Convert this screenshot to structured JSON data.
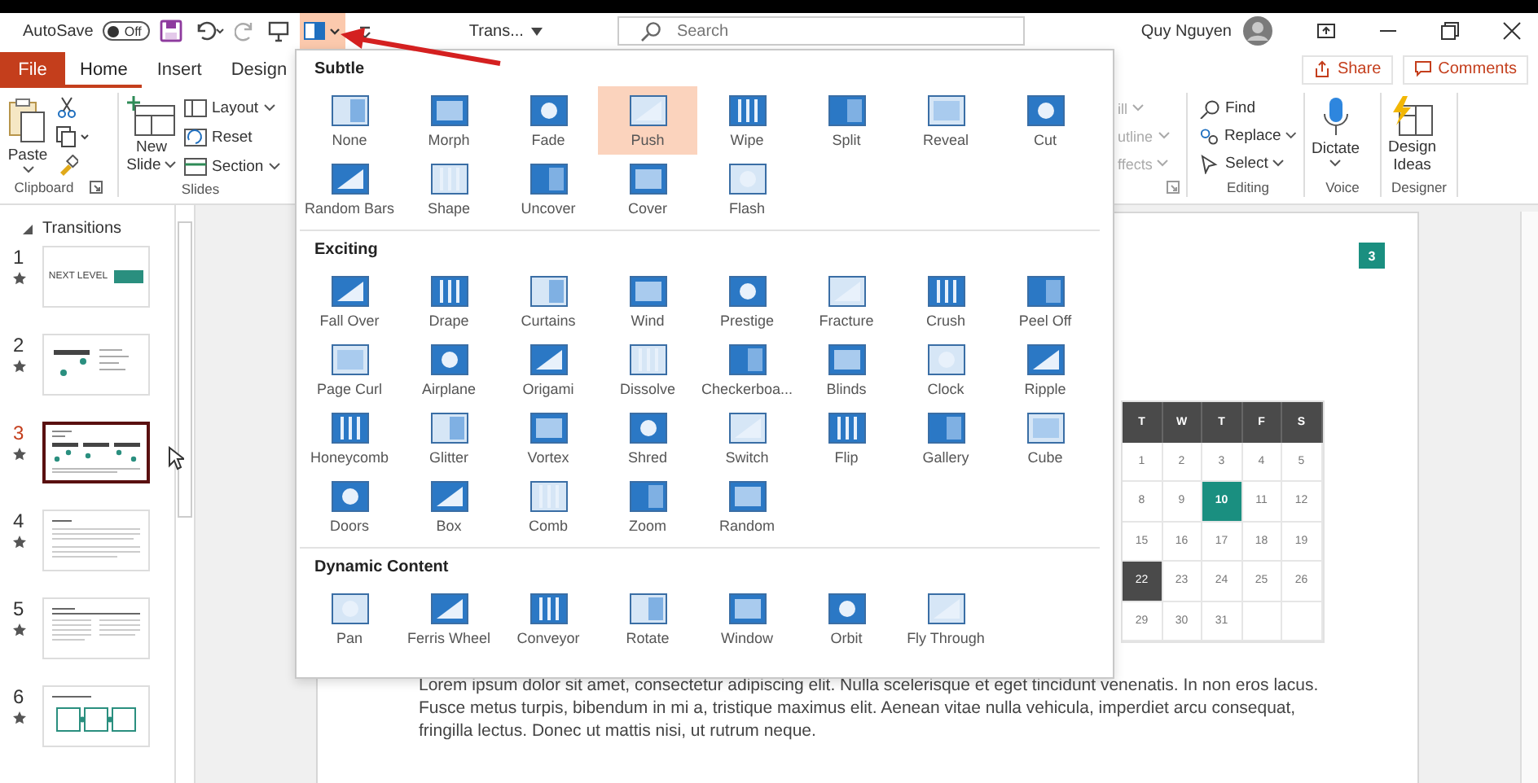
{
  "top_bar": {
    "autosave_label": "AutoSave",
    "autosave_toggle": {
      "label": "Off",
      "on": false
    },
    "document_title": "Trans...",
    "search": {
      "placeholder": "Search"
    },
    "user_name": "Quy Nguyen"
  },
  "ribbon_tabs": [
    {
      "label": "File",
      "kind": "file",
      "selected": false
    },
    {
      "label": "Home",
      "kind": "tab",
      "selected": true
    },
    {
      "label": "Insert",
      "kind": "tab",
      "selected": false
    },
    {
      "label": "Design",
      "kind": "tab",
      "selected": false
    }
  ],
  "share_button": "Share",
  "comments_button": "Comments",
  "ribbon": {
    "paste": "Paste",
    "clipboard_label": "Clipboard",
    "new_slide": [
      "New",
      "Slide"
    ],
    "layout": "Layout",
    "reset": "Reset",
    "section": "Section",
    "slides_label": "Slides",
    "cut_items": [
      "ill",
      "utline",
      "ffects"
    ],
    "find": "Find",
    "replace": "Replace",
    "select": "Select",
    "editing_label": "Editing",
    "dictate": "Dictate",
    "voice_label": "Voice",
    "design_ideas": [
      "Design",
      "Ideas"
    ],
    "designer_label": "Designer"
  },
  "slides_panel": {
    "section": "Transitions",
    "slides": [
      {
        "number": "1",
        "kind": "title",
        "text": "NEXT LEVEL",
        "selected": false
      },
      {
        "number": "2",
        "kind": "dots",
        "selected": false
      },
      {
        "number": "3",
        "kind": "timeline",
        "selected": true
      },
      {
        "number": "4",
        "kind": "text",
        "selected": false
      },
      {
        "number": "5",
        "kind": "columns",
        "selected": false
      },
      {
        "number": "6",
        "kind": "boxes",
        "selected": false
      }
    ]
  },
  "gallery": {
    "sections": [
      {
        "title": "Subtle",
        "items": [
          {
            "label": "None",
            "selected": false
          },
          {
            "label": "Morph",
            "selected": false
          },
          {
            "label": "Fade",
            "selected": false
          },
          {
            "label": "Push",
            "selected": true
          },
          {
            "label": "Wipe",
            "selected": false
          },
          {
            "label": "Split",
            "selected": false
          },
          {
            "label": "Reveal",
            "selected": false
          },
          {
            "label": "Cut",
            "selected": false
          },
          {
            "label": "Random Bars",
            "selected": false
          },
          {
            "label": "Shape",
            "selected": false
          },
          {
            "label": "Uncover",
            "selected": false
          },
          {
            "label": "Cover",
            "selected": false
          },
          {
            "label": "Flash",
            "selected": false
          }
        ]
      },
      {
        "title": "Exciting",
        "items": [
          {
            "label": "Fall Over",
            "selected": false
          },
          {
            "label": "Drape",
            "selected": false
          },
          {
            "label": "Curtains",
            "selected": false
          },
          {
            "label": "Wind",
            "selected": false
          },
          {
            "label": "Prestige",
            "selected": false
          },
          {
            "label": "Fracture",
            "selected": false
          },
          {
            "label": "Crush",
            "selected": false
          },
          {
            "label": "Peel Off",
            "selected": false
          },
          {
            "label": "Page Curl",
            "selected": false
          },
          {
            "label": "Airplane",
            "selected": false
          },
          {
            "label": "Origami",
            "selected": false
          },
          {
            "label": "Dissolve",
            "selected": false
          },
          {
            "label": "Checkerboa...",
            "selected": false
          },
          {
            "label": "Blinds",
            "selected": false
          },
          {
            "label": "Clock",
            "selected": false
          },
          {
            "label": "Ripple",
            "selected": false
          },
          {
            "label": "Honeycomb",
            "selected": false
          },
          {
            "label": "Glitter",
            "selected": false
          },
          {
            "label": "Vortex",
            "selected": false
          },
          {
            "label": "Shred",
            "selected": false
          },
          {
            "label": "Switch",
            "selected": false
          },
          {
            "label": "Flip",
            "selected": false
          },
          {
            "label": "Gallery",
            "selected": false
          },
          {
            "label": "Cube",
            "selected": false
          },
          {
            "label": "Doors",
            "selected": false
          },
          {
            "label": "Box",
            "selected": false
          },
          {
            "label": "Comb",
            "selected": false
          },
          {
            "label": "Zoom",
            "selected": false
          },
          {
            "label": "Random",
            "selected": false
          }
        ]
      },
      {
        "title": "Dynamic Content",
        "items": [
          {
            "label": "Pan",
            "selected": false
          },
          {
            "label": "Ferris Wheel",
            "selected": false
          },
          {
            "label": "Conveyor",
            "selected": false
          },
          {
            "label": "Rotate",
            "selected": false
          },
          {
            "label": "Window",
            "selected": false
          },
          {
            "label": "Orbit",
            "selected": false
          },
          {
            "label": "Fly Through",
            "selected": false
          }
        ]
      }
    ]
  },
  "slide": {
    "page_badge": "3",
    "calendar": {
      "headers": [
        "T",
        "W",
        "T",
        "F",
        "S"
      ],
      "rows": [
        [
          {
            "text": "1",
            "kind": "plain"
          },
          {
            "text": "2",
            "kind": "plain"
          },
          {
            "text": "3",
            "kind": "plain"
          },
          {
            "text": "4",
            "kind": "plain"
          },
          {
            "text": "5",
            "kind": "plain"
          }
        ],
        [
          {
            "text": "8",
            "kind": "plain"
          },
          {
            "text": "9",
            "kind": "plain"
          },
          {
            "text": "10",
            "kind": "accent"
          },
          {
            "text": "11",
            "kind": "plain"
          },
          {
            "text": "12",
            "kind": "plain"
          }
        ],
        [
          {
            "text": "15",
            "kind": "plain"
          },
          {
            "text": "16",
            "kind": "plain"
          },
          {
            "text": "17",
            "kind": "plain"
          },
          {
            "text": "18",
            "kind": "plain"
          },
          {
            "text": "19",
            "kind": "plain"
          }
        ],
        [
          {
            "text": "22",
            "kind": "dark"
          },
          {
            "text": "23",
            "kind": "plain"
          },
          {
            "text": "24",
            "kind": "plain"
          },
          {
            "text": "25",
            "kind": "plain"
          },
          {
            "text": "26",
            "kind": "plain"
          }
        ],
        [
          {
            "text": "29",
            "kind": "plain"
          },
          {
            "text": "30",
            "kind": "plain"
          },
          {
            "text": "31",
            "kind": "plain"
          },
          {
            "kind": "plain"
          },
          {
            "kind": "plain"
          }
        ]
      ]
    },
    "body": "Lorem ipsum dolor sit amet, consectetur adipiscing elit. Nulla scelerisque et eget tincidunt venenatis. In non eros lacus. Fusce metus turpis, bibendum in mi a, tristique maximus elit. Aenean vitae nulla vehicula, imperdiet arcu consequat, fringilla lectus. Donec ut mattis nisi, ut rutrum neque."
  }
}
